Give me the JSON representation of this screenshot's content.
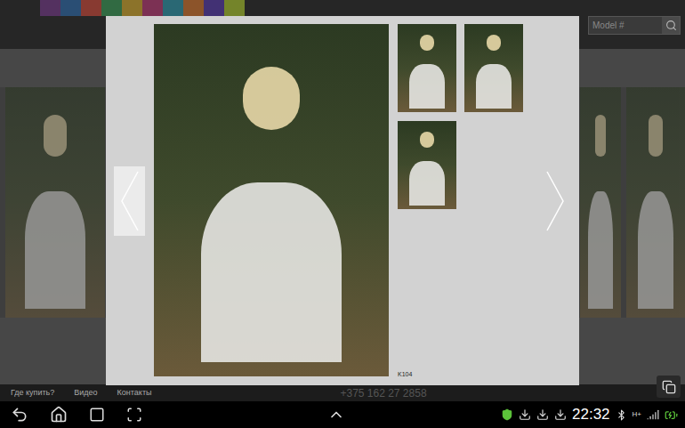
{
  "site": {
    "search": {
      "placeholder": "Model #"
    },
    "footer": {
      "links": [
        "Где купить?",
        "Видео",
        "Контакты"
      ],
      "phone": "+375 162 27 2858"
    }
  },
  "lightbox": {
    "caption": "K104",
    "thumbnails": [
      {
        "selected": false
      },
      {
        "selected": false
      },
      {
        "selected": false
      }
    ]
  },
  "status_bar": {
    "time": "22:32",
    "network": "H+"
  }
}
